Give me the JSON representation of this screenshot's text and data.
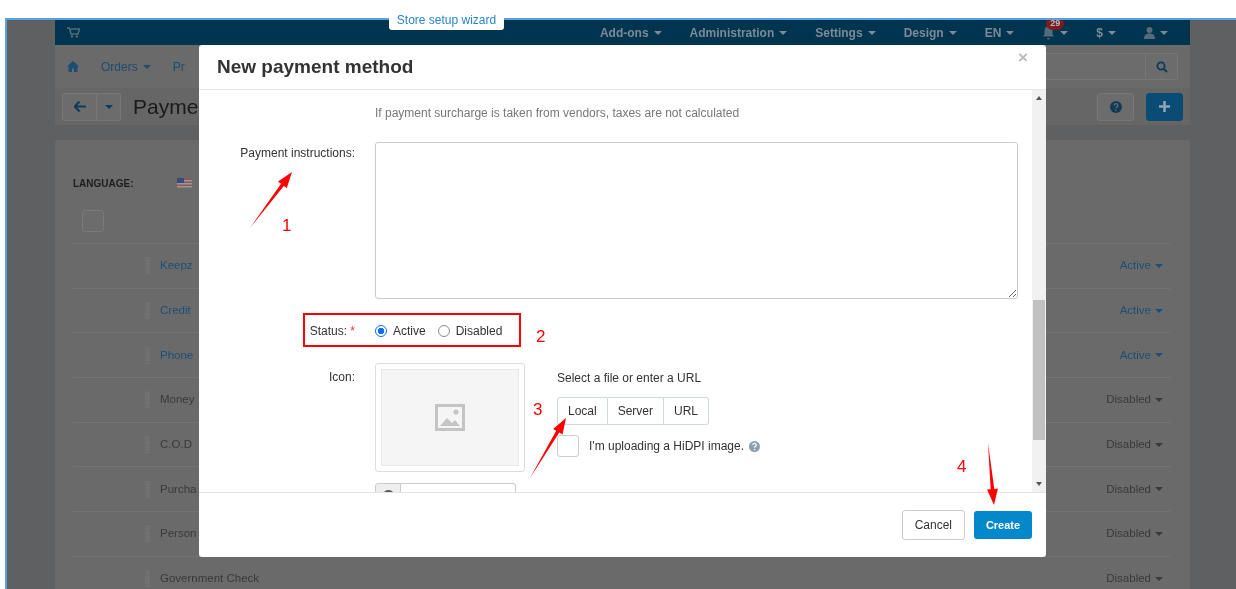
{
  "header": {
    "wizard_button": "Store setup wizard",
    "menus": [
      {
        "label": "Add-ons"
      },
      {
        "label": "Administration"
      },
      {
        "label": "Settings"
      },
      {
        "label": "Design"
      },
      {
        "label": "EN"
      }
    ],
    "notification_count": "29",
    "currency": "$"
  },
  "subnav": {
    "items": [
      {
        "label": "Orders",
        "dropdown": true
      },
      {
        "label": "Pr",
        "dropdown": false
      }
    ]
  },
  "page_title": "Payme",
  "select_all": {
    "checked": false
  },
  "panel": {
    "language_label": "LANGUAGE:",
    "rows": [
      {
        "name": "Keepz",
        "status": "Active",
        "active": true
      },
      {
        "name": "Credit",
        "status": "Active",
        "active": true
      },
      {
        "name": "Phone",
        "status": "Active",
        "active": true
      },
      {
        "name": "Money",
        "status": "Disabled",
        "active": false
      },
      {
        "name": "C.O.D",
        "status": "Disabled",
        "active": false
      },
      {
        "name": "Purcha",
        "status": "Disabled",
        "active": false
      },
      {
        "name": "Person",
        "status": "Disabled",
        "active": false
      },
      {
        "name": "Government Check",
        "status": "Disabled",
        "active": false
      }
    ]
  },
  "modal": {
    "title": "New payment method",
    "close": "×",
    "taxes_hint": "If payment surcharge is taken from vendors, taxes are not calculated",
    "instructions_label": "Payment instructions:",
    "status": {
      "label": "Status:",
      "required_mark": "*",
      "options": [
        {
          "label": "Active",
          "selected": true
        },
        {
          "label": "Disabled",
          "selected": false
        }
      ]
    },
    "icon": {
      "label": "Icon:",
      "hint": "Select a file or enter a URL",
      "sources": [
        {
          "label": "Local"
        },
        {
          "label": "Server"
        },
        {
          "label": "URL"
        }
      ],
      "hidpi": {
        "label": "I'm uploading a HiDPI image.",
        "checked": false
      }
    },
    "buttons": {
      "cancel": "Cancel",
      "create": "Create"
    }
  },
  "annotations": [
    {
      "number": "1"
    },
    {
      "number": "2"
    },
    {
      "number": "3"
    },
    {
      "number": "4"
    }
  ]
}
